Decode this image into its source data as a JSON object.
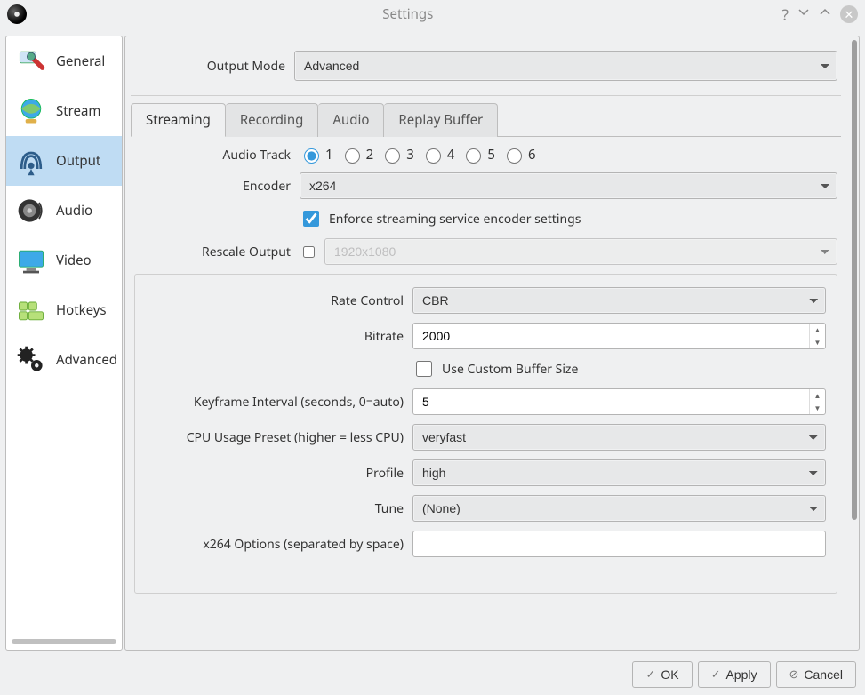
{
  "window": {
    "title": "Settings"
  },
  "sidebar": {
    "items": [
      {
        "label": "General"
      },
      {
        "label": "Stream"
      },
      {
        "label": "Output"
      },
      {
        "label": "Audio"
      },
      {
        "label": "Video"
      },
      {
        "label": "Hotkeys"
      },
      {
        "label": "Advanced"
      }
    ],
    "selected_index": 2
  },
  "output_mode": {
    "label": "Output Mode",
    "value": "Advanced"
  },
  "tabs": {
    "items": [
      {
        "label": "Streaming"
      },
      {
        "label": "Recording"
      },
      {
        "label": "Audio"
      },
      {
        "label": "Replay Buffer"
      }
    ],
    "active_index": 0
  },
  "streaming": {
    "audio_track": {
      "label": "Audio Track",
      "options": [
        "1",
        "2",
        "3",
        "4",
        "5",
        "6"
      ],
      "selected": "1"
    },
    "encoder": {
      "label": "Encoder",
      "value": "x264"
    },
    "enforce": {
      "label": "Enforce streaming service encoder settings",
      "checked": true
    },
    "rescale": {
      "label": "Rescale Output",
      "checked": false,
      "value": "1920x1080"
    }
  },
  "x264": {
    "rate_control": {
      "label": "Rate Control",
      "value": "CBR"
    },
    "bitrate": {
      "label": "Bitrate",
      "value": "2000"
    },
    "custom_buffer": {
      "label": "Use Custom Buffer Size",
      "checked": false
    },
    "keyint": {
      "label": "Keyframe Interval (seconds, 0=auto)",
      "value": "5"
    },
    "cpu_preset": {
      "label": "CPU Usage Preset (higher = less CPU)",
      "value": "veryfast"
    },
    "profile": {
      "label": "Profile",
      "value": "high"
    },
    "tune": {
      "label": "Tune",
      "value": "(None)"
    },
    "options": {
      "label": "x264 Options (separated by space)",
      "value": ""
    }
  },
  "buttons": {
    "ok": "OK",
    "apply": "Apply",
    "cancel": "Cancel"
  }
}
